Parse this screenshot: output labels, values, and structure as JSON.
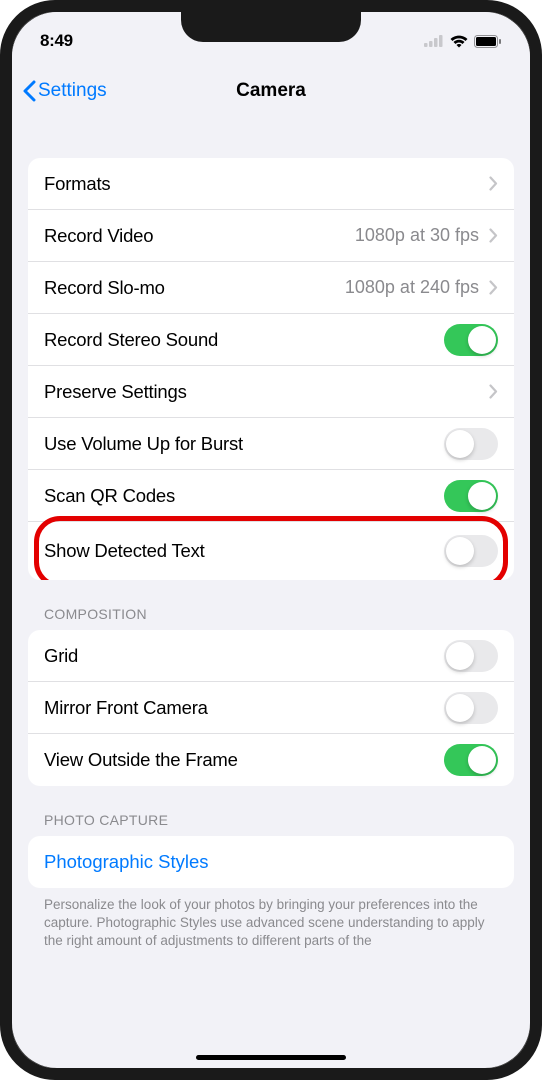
{
  "status": {
    "time": "8:49"
  },
  "nav": {
    "back_label": "Settings",
    "title": "Camera"
  },
  "group1": {
    "formats": {
      "label": "Formats"
    },
    "record_video": {
      "label": "Record Video",
      "value": "1080p at 30 fps"
    },
    "record_slomo": {
      "label": "Record Slo-mo",
      "value": "1080p at 240 fps"
    },
    "stereo": {
      "label": "Record Stereo Sound",
      "on": true
    },
    "preserve": {
      "label": "Preserve Settings"
    },
    "vol_burst": {
      "label": "Use Volume Up for Burst",
      "on": false
    },
    "scan_qr": {
      "label": "Scan QR Codes",
      "on": true
    },
    "detected_text": {
      "label": "Show Detected Text",
      "on": false
    }
  },
  "composition": {
    "header": "COMPOSITION",
    "grid": {
      "label": "Grid",
      "on": false
    },
    "mirror": {
      "label": "Mirror Front Camera",
      "on": false
    },
    "outside_frame": {
      "label": "View Outside the Frame",
      "on": true
    }
  },
  "photo_capture": {
    "header": "PHOTO CAPTURE",
    "styles": {
      "label": "Photographic Styles"
    },
    "footer": "Personalize the look of your photos by bringing your preferences into the capture. Photographic Styles use advanced scene understanding to apply the right amount of adjustments to different parts of the"
  }
}
